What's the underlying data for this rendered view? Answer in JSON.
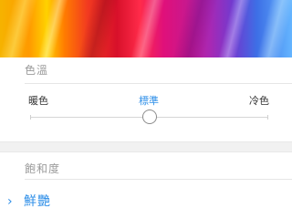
{
  "color_temperature": {
    "title": "色溫",
    "options": [
      {
        "label": "暖色"
      },
      {
        "label": "標準"
      },
      {
        "label": "冷色"
      }
    ],
    "selected": "標準",
    "slider_value": 0.5
  },
  "saturation": {
    "title": "飽和度",
    "selected_option": "鮮艷"
  },
  "colors": {
    "accent": "#2f8fe8",
    "section_label": "#9a9a9a",
    "text": "#333333"
  },
  "icons": {
    "selected_marker": "chevron-right-icon"
  }
}
